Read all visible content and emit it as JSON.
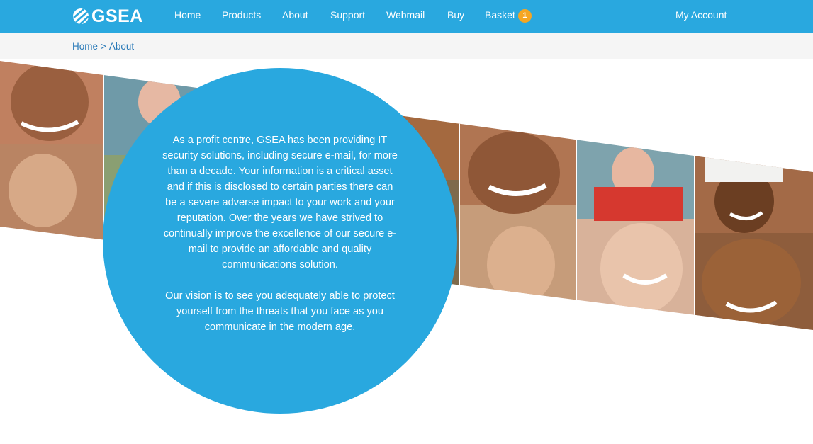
{
  "header": {
    "logo_text": "GSEA",
    "nav": [
      {
        "label": "Home"
      },
      {
        "label": "Products"
      },
      {
        "label": "About"
      },
      {
        "label": "Support"
      },
      {
        "label": "Webmail"
      },
      {
        "label": "Buy"
      },
      {
        "label": "Basket"
      }
    ],
    "basket_count": "1",
    "account_label": "My Account",
    "colors": {
      "bar": "#29a8df",
      "badge": "#f5a623"
    }
  },
  "breadcrumb": {
    "home": "Home",
    "separator": ">",
    "current": "About"
  },
  "hero": {
    "image": "people-faces-collage",
    "paragraph_1": "As a profit centre, GSEA has been providing IT security solutions, including secure e-mail, for more than a decade. Your information is a critical asset and if this is disclosed to certain parties there can be a severe adverse impact to your work and your reputation. Over the years we have strived to continually improve the excellence of our secure e-mail to provide an affordable and quality communications solution.",
    "paragraph_2": "Our vision is to see you adequately able to protect yourself from the threats that you face as you communicate in the modern age.",
    "circle_color": "#29a8df"
  }
}
